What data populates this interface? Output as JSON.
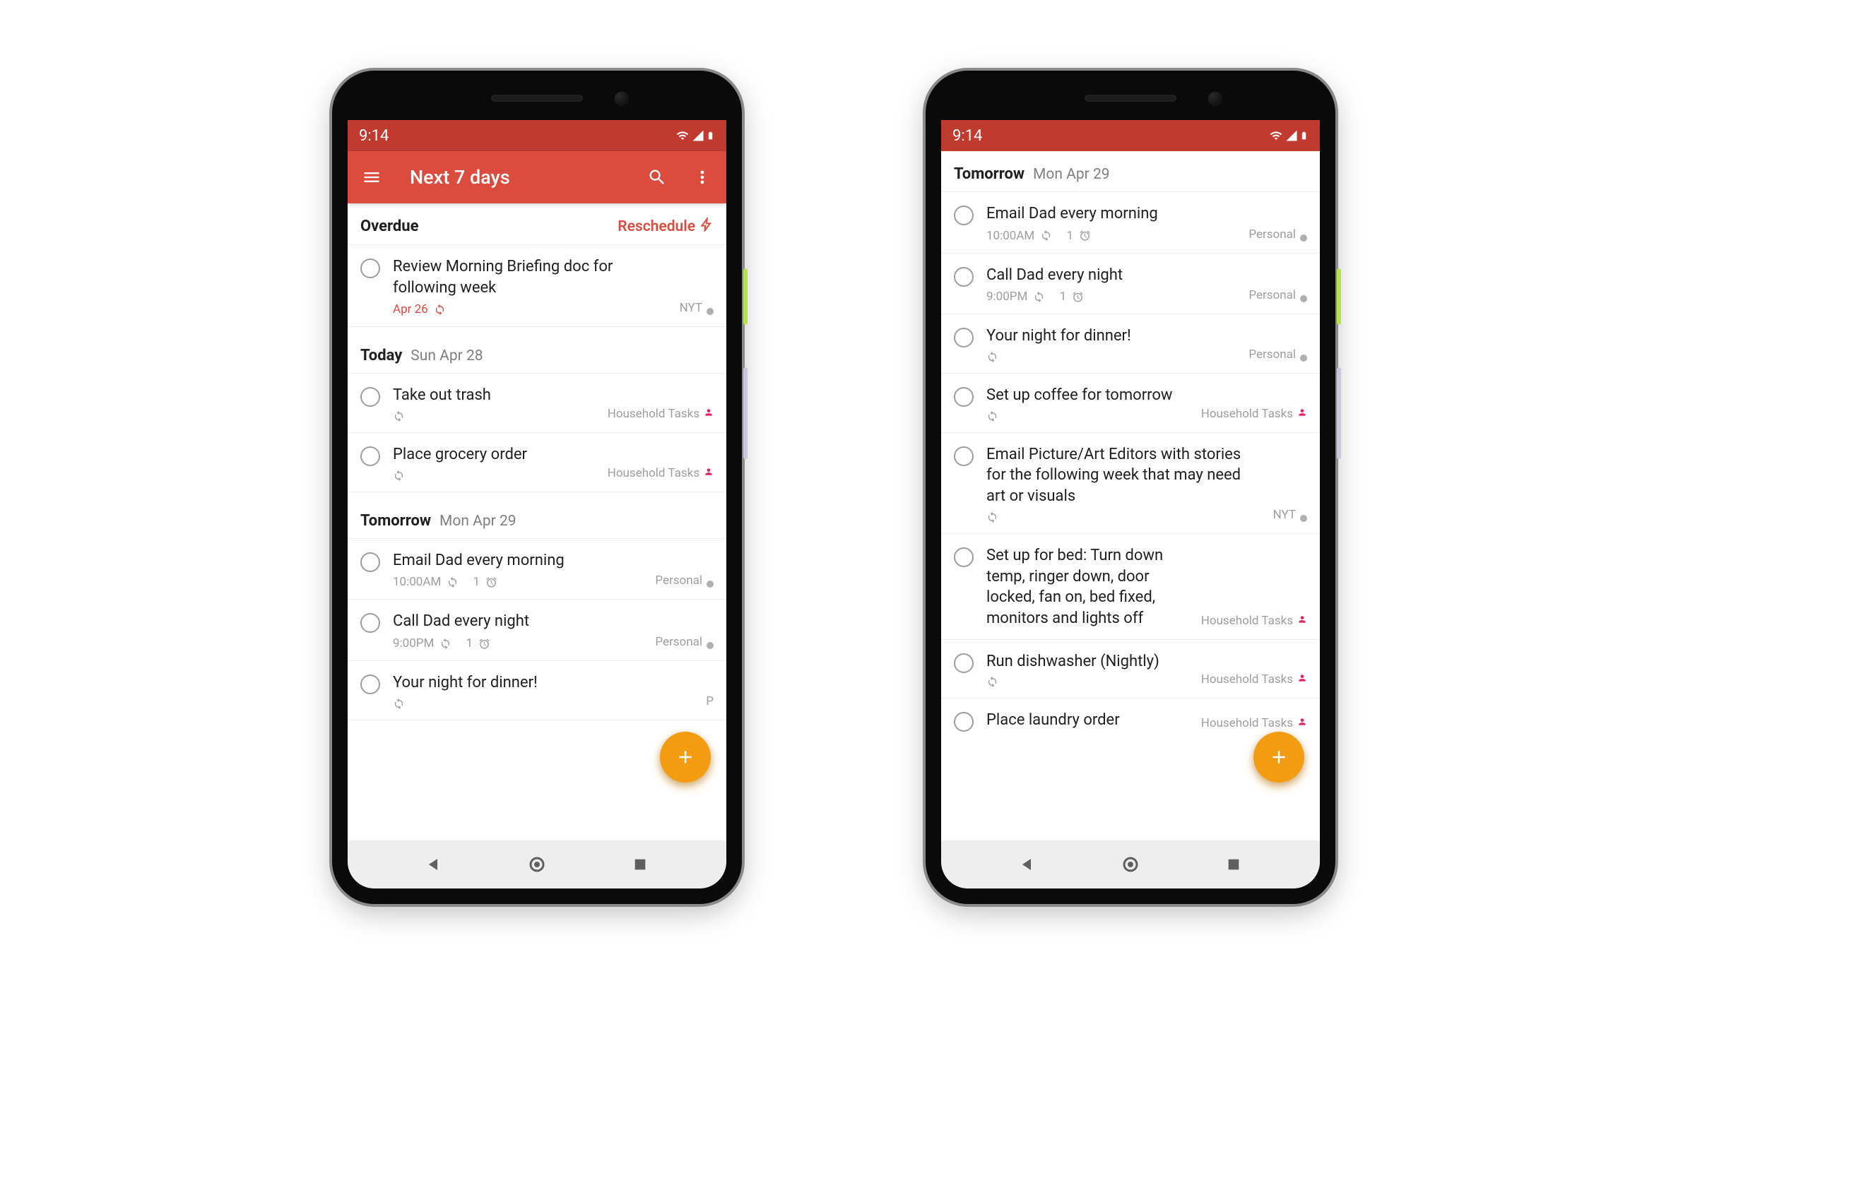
{
  "statusbar": {
    "time": "9:14"
  },
  "appbar": {
    "title": "Next 7 days"
  },
  "phone1": {
    "sections": {
      "overdue": {
        "label": "Overdue",
        "action": "Reschedule",
        "tasks": [
          {
            "title": "Review Morning Briefing doc for following week",
            "date": "Apr 26",
            "project": "NYT"
          }
        ]
      },
      "today": {
        "label": "Today",
        "date": "Sun Apr 28",
        "tasks": [
          {
            "title": "Take out trash",
            "project": "Household Tasks"
          },
          {
            "title": "Place grocery order",
            "project": "Household Tasks"
          }
        ]
      },
      "tomorrow": {
        "label": "Tomorrow",
        "date": "Mon Apr 29",
        "tasks": [
          {
            "title": "Email Dad every morning",
            "time": "10:00AM",
            "reminders": "1",
            "project": "Personal"
          },
          {
            "title": "Call Dad every night",
            "time": "9:00PM",
            "reminders": "1",
            "project": "Personal"
          },
          {
            "title": "Your night for dinner!",
            "project_short": "P"
          }
        ]
      }
    }
  },
  "phone2": {
    "section": {
      "label": "Tomorrow",
      "date": "Mon Apr 29",
      "tasks": [
        {
          "title": "Email Dad every morning",
          "time": "10:00AM",
          "reminders": "1",
          "project": "Personal"
        },
        {
          "title": "Call Dad every night",
          "time": "9:00PM",
          "reminders": "1",
          "project": "Personal"
        },
        {
          "title": "Your night for dinner!",
          "project": "Personal"
        },
        {
          "title": "Set up coffee for tomorrow",
          "project": "Household Tasks"
        },
        {
          "title": "Email Picture/Art Editors with stories for the following week that may need art or visuals",
          "project": "NYT"
        },
        {
          "title": "Set up for bed: Turn down temp, ringer down, door locked, fan on, bed fixed, monitors and lights off",
          "project": "Household Tasks"
        },
        {
          "title": "Run dishwasher (Nightly)",
          "project": "Household Tasks"
        },
        {
          "title": "Place laundry order",
          "project": "Household Tasks"
        }
      ]
    }
  }
}
